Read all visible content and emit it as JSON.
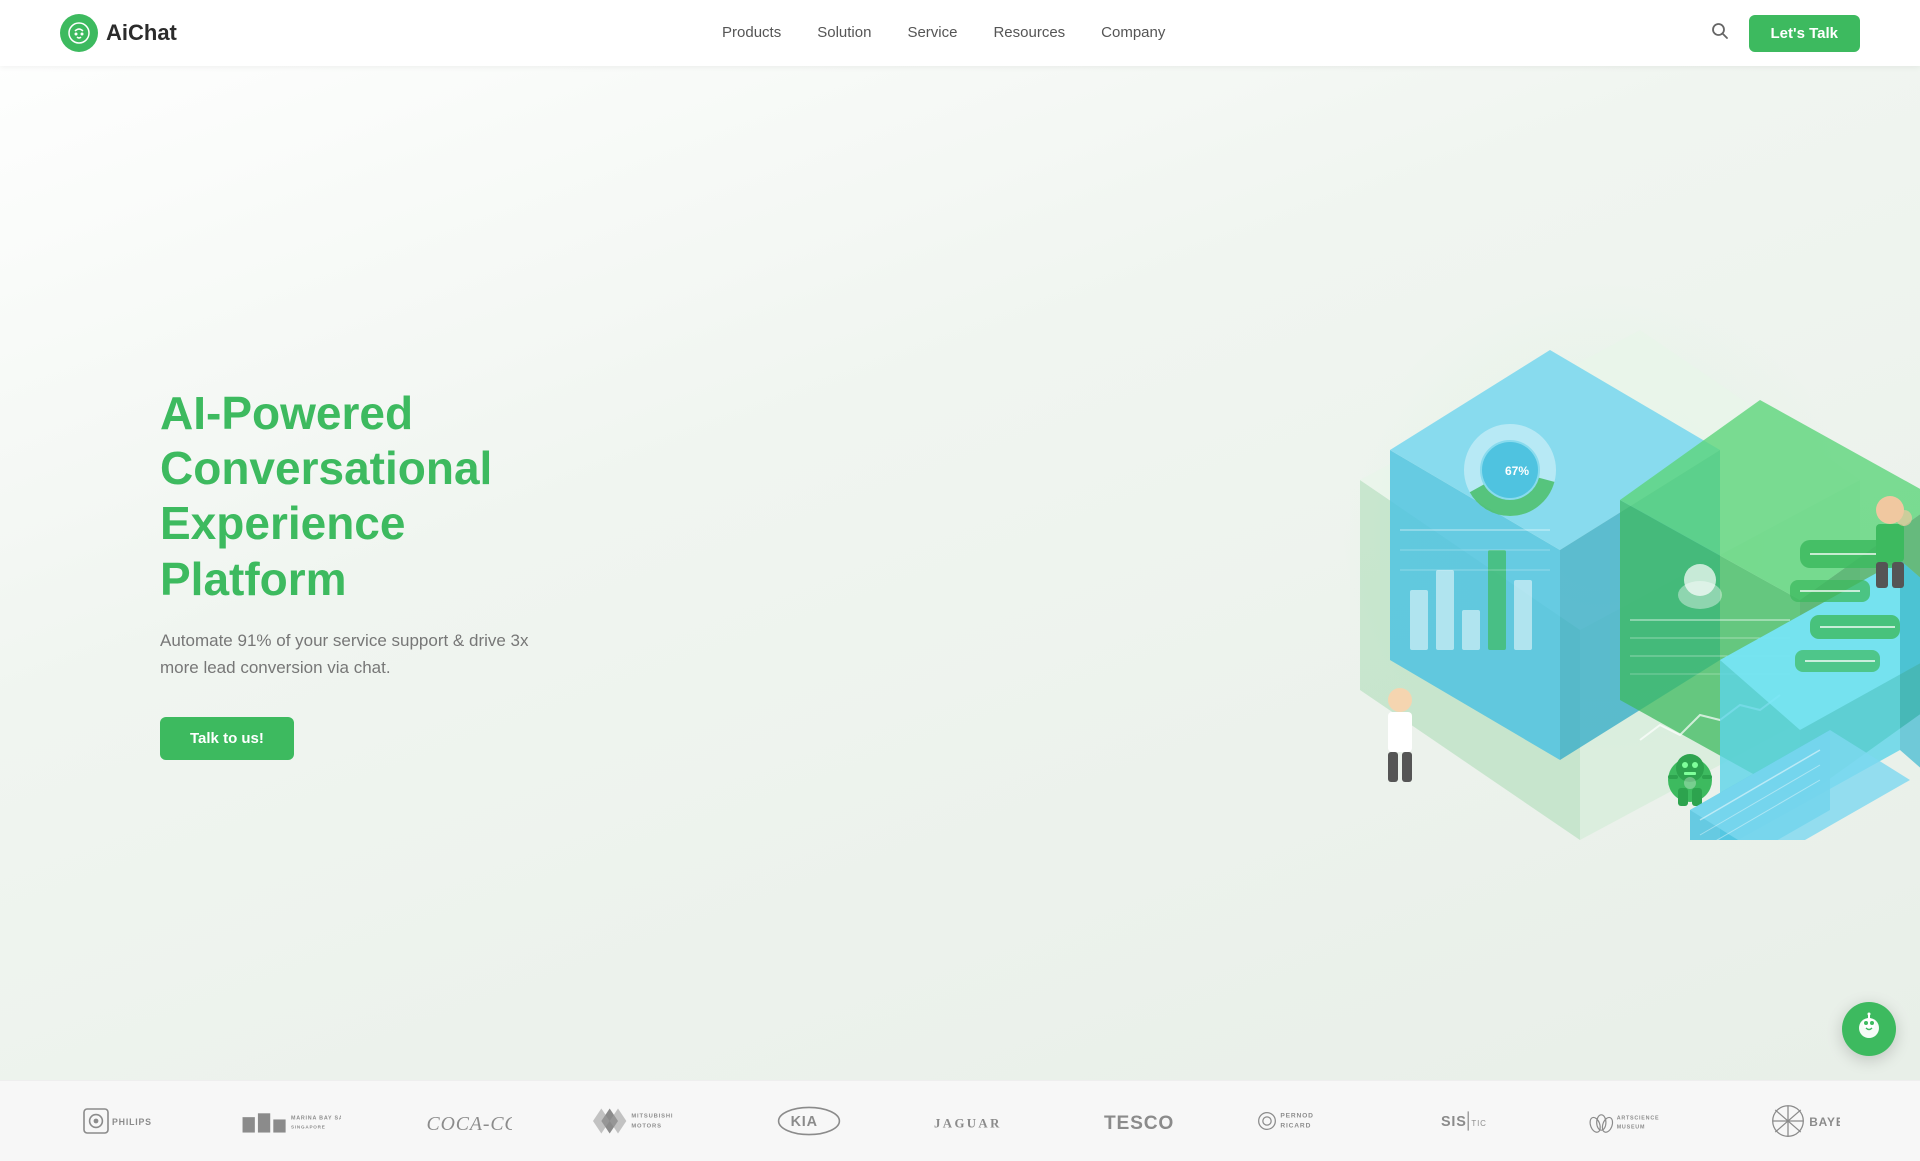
{
  "brand": {
    "name": "AiChat",
    "logo_letter": "A"
  },
  "nav": {
    "links": [
      {
        "label": "Products",
        "id": "products"
      },
      {
        "label": "Solution",
        "id": "solution"
      },
      {
        "label": "Service",
        "id": "service"
      },
      {
        "label": "Resources",
        "id": "resources"
      },
      {
        "label": "Company",
        "id": "company"
      }
    ],
    "cta_label": "Let's Talk"
  },
  "hero": {
    "title": "AI-Powered Conversational Experience Platform",
    "subtitle": "Automate 91% of your service support & drive 3x more lead conversion via chat.",
    "cta_label": "Talk to us!"
  },
  "clients": [
    {
      "name": "Philips",
      "id": "philips"
    },
    {
      "name": "Marina Bay Sands",
      "id": "mbs"
    },
    {
      "name": "Coca-Cola",
      "id": "cocacola"
    },
    {
      "name": "Mitsubishi Motors",
      "id": "mitsubishi"
    },
    {
      "name": "KIA",
      "id": "kia"
    },
    {
      "name": "Jaguar",
      "id": "jaguar"
    },
    {
      "name": "TESCO",
      "id": "tesco"
    },
    {
      "name": "Pernod Ricard",
      "id": "pernod"
    },
    {
      "name": "SISTIC",
      "id": "sistic"
    },
    {
      "name": "ArtScience Museum",
      "id": "artscience"
    },
    {
      "name": "Bayer",
      "id": "bayer"
    }
  ],
  "colors": {
    "primary": "#3dba5f",
    "primary_dark": "#2da34e",
    "text_dark": "#2b2b2b",
    "text_muted": "#777777"
  }
}
